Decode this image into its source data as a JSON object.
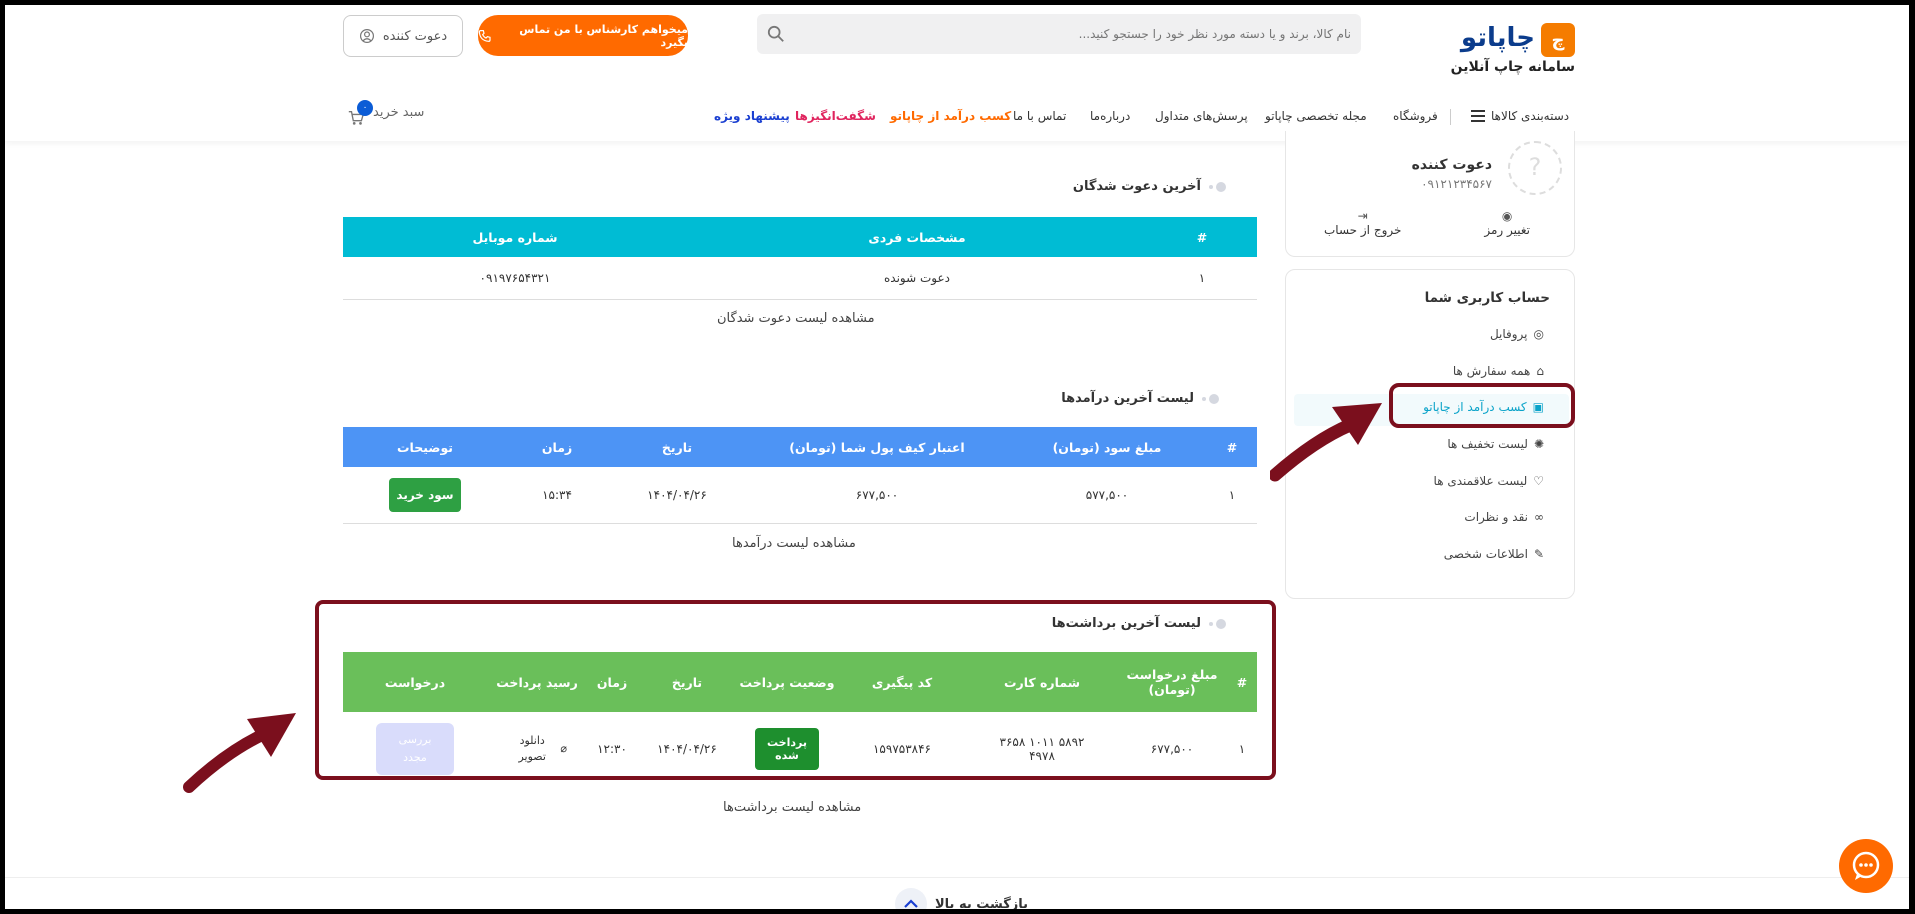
{
  "header": {
    "brand": "چاپاتو",
    "brand_sub": "سامانه چاپ آنلاین",
    "search_placeholder": "نام کالا، برند و یا دسته مورد نظر خود را جستجو کنید...",
    "call_button": "میخواهم کارشناس با من تماس بگیرد",
    "user_button": "دعوت کننده",
    "cart_label": "سبد خرید",
    "cart_count": "۰",
    "nav": {
      "categories": "دسته‌بندی کالاها",
      "shop": "فروشگاه",
      "magazine": "مجله تخصصی چاپاتو",
      "faq": "پرسش‌های متداول",
      "about": "درباره‌ما",
      "contact": "تماس با ما",
      "earn": "کسب درآمد از چاپاتو",
      "wonders": "شگفت‌انگیزها",
      "special": "پیشنهاد ویژه"
    }
  },
  "profile": {
    "name": "دعوت کننده",
    "phone": "۰۹۱۲۱۲۳۴۵۶۷",
    "change_password": "تغییر رمز",
    "logout": "خروج از حساب"
  },
  "account_menu": {
    "title": "حساب کاربری شما",
    "items": [
      {
        "label": "پروفایل",
        "icon": "user-circle-icon"
      },
      {
        "label": "همه سفارش ها",
        "icon": "basket-icon"
      },
      {
        "label": "کسب درآمد از چاپاتو",
        "icon": "money-icon"
      },
      {
        "label": "لیست تخفیف ها",
        "icon": "discount-icon"
      },
      {
        "label": "لیست علاقمندی ها",
        "icon": "heart-icon"
      },
      {
        "label": "نقد و نظرات",
        "icon": "glasses-icon"
      },
      {
        "label": "اطلاعات شخصی",
        "icon": "user-edit-icon"
      }
    ]
  },
  "invitees": {
    "title": "آخرین دعوت شدگان",
    "headers": [
      "#",
      "مشخصات فردی",
      "شماره موبایل"
    ],
    "rows": [
      [
        "۱",
        "دعوت شونده",
        "۰۹۱۹۷۶۵۴۳۲۱"
      ]
    ],
    "link": "مشاهده لیست دعوت شدگان",
    "color": "#00bcd4"
  },
  "incomes": {
    "title": "لیست آخرین درآمدها",
    "headers": [
      "#",
      "مبلغ سود (تومان)",
      "اعتبار کیف پول شما (تومان)",
      "تاریخ",
      "زمان",
      "توضیحات"
    ],
    "rows": [
      [
        "۱",
        "۵۷۷,۵۰۰",
        "۶۷۷,۵۰۰",
        "۱۴۰۴/۰۴/۲۶",
        "۱۵:۳۴",
        "سود خرید"
      ]
    ],
    "link": "مشاهده لیست درآمدها",
    "color": "#4d94f5"
  },
  "withdrawals": {
    "title": "لیست آخرین برداشت‌ها",
    "headers": [
      "#",
      "مبلغ درخواست (تومان)",
      "شماره کارت",
      "کد پیگیری",
      "وضعیت پرداخت",
      "تاریخ",
      "زمان",
      "رسید پرداخت",
      "درخواست"
    ],
    "rows": [
      [
        "۱",
        "۶۷۷,۵۰۰",
        "۵۸۹۲ ۱۰۱۱ ۳۶۵۸ ۴۹۷۸",
        "۱۵۹۷۵۳۸۴۶",
        "پرداخت شده",
        "۱۴۰۴/۰۴/۲۶",
        "۱۲:۳۰",
        "دانلود تصویر",
        "بررسی مجدد"
      ]
    ],
    "link": "مشاهده لیست برداشت‌ها",
    "color": "#6abf5a"
  },
  "footer": {
    "back_to_top": "بازگشت به بالا"
  },
  "colors": {
    "highlight": "#7b0f1d",
    "orange": "#ff6a00",
    "brand_blue": "#0b3c8c"
  }
}
